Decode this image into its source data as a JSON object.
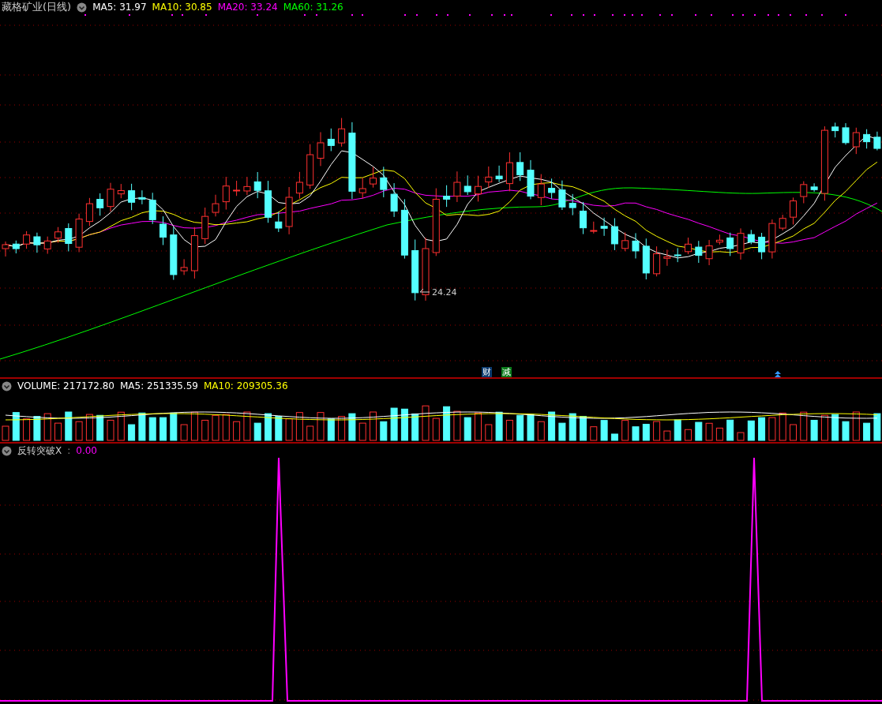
{
  "main_panel": {
    "stock_title": "藏格矿业(日线)",
    "legend": [
      {
        "label": "MA5: 31.97",
        "color": "#ffffff"
      },
      {
        "label": "MA10: 30.85",
        "color": "#ffff00"
      },
      {
        "label": "MA20: 33.24",
        "color": "#ff00ff"
      },
      {
        "label": "MA60: 31.26",
        "color": "#00ff00"
      }
    ],
    "low_label": "24.24",
    "markers": [
      {
        "label": "财",
        "color": "#0a3a6e"
      },
      {
        "label": "减",
        "color": "#0a7a1a"
      }
    ]
  },
  "volume_panel": {
    "legend": [
      {
        "label": "VOLUME: 217172.80",
        "color": "#ffffff"
      },
      {
        "label": "MA5: 251335.59",
        "color": "#ffffff"
      },
      {
        "label": "MA10: 209305.36",
        "color": "#ffff00"
      }
    ]
  },
  "indicator_panel": {
    "name": "反转突破X",
    "separator": ":",
    "value": "0.00"
  }
}
